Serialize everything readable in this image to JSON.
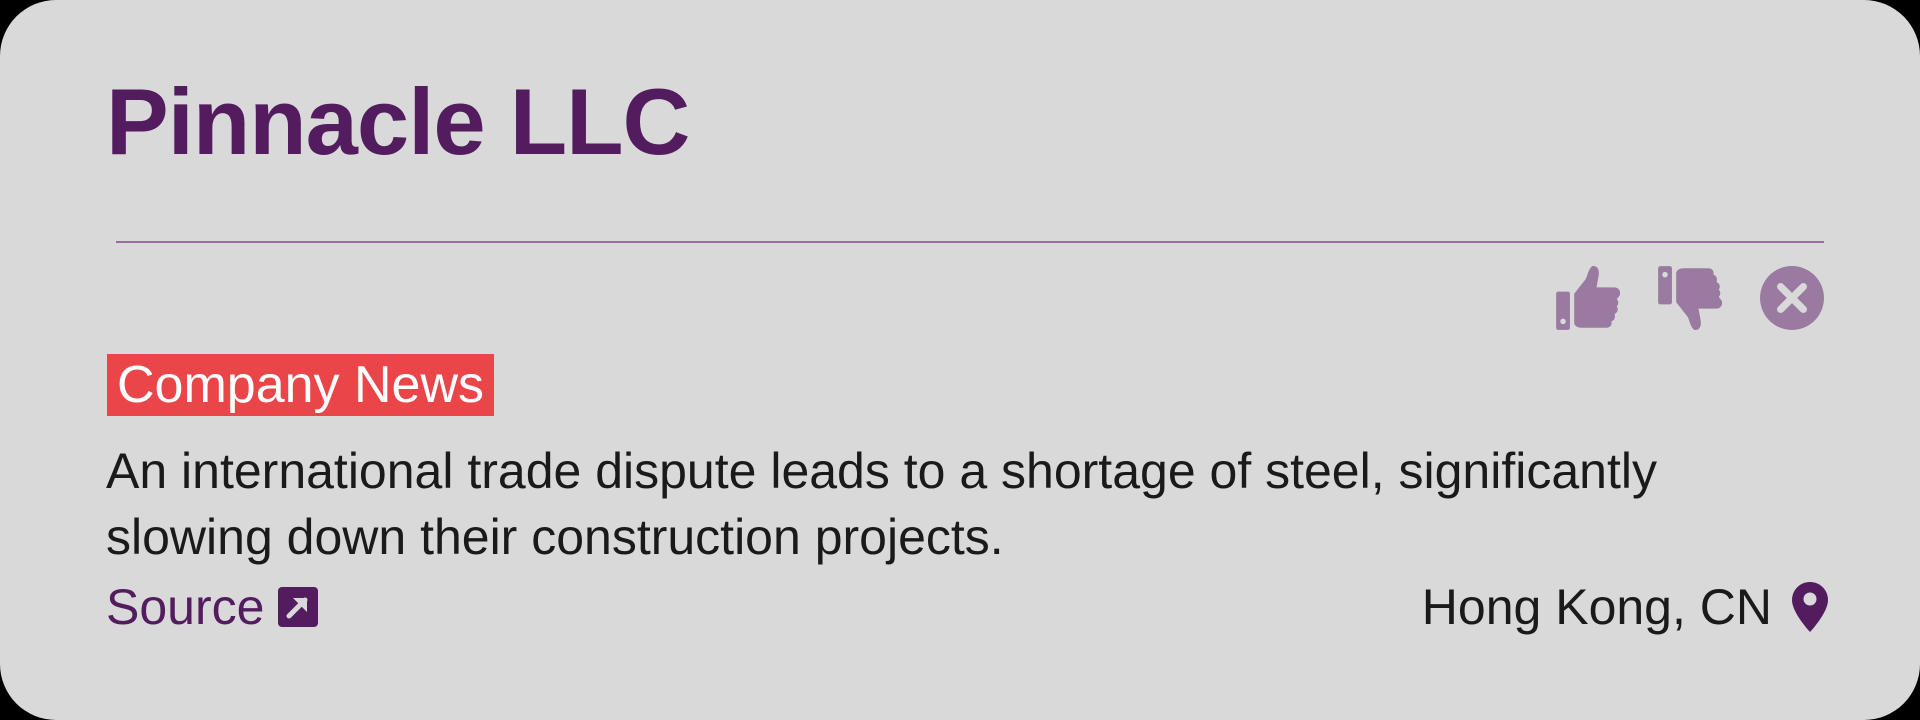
{
  "card": {
    "company_name": "Pinnacle LLC",
    "category_badge": "Company News",
    "description": "An international trade dispute leads to a shortage of steel, significantly slowing down their construction projects.",
    "source_label": "Source",
    "location": "Hong Kong, CN"
  },
  "icons": {
    "like": "thumbs-up-icon",
    "dislike": "thumbs-down-icon",
    "dismiss": "close-circle-icon",
    "external_link": "external-link-icon",
    "location": "map-pin-icon"
  },
  "colors": {
    "background": "#d9d9d9",
    "brand_purple": "#521c5f",
    "muted_purple": "#9a7aa0",
    "badge_red": "#ea4649",
    "text": "#1a1a1a"
  }
}
